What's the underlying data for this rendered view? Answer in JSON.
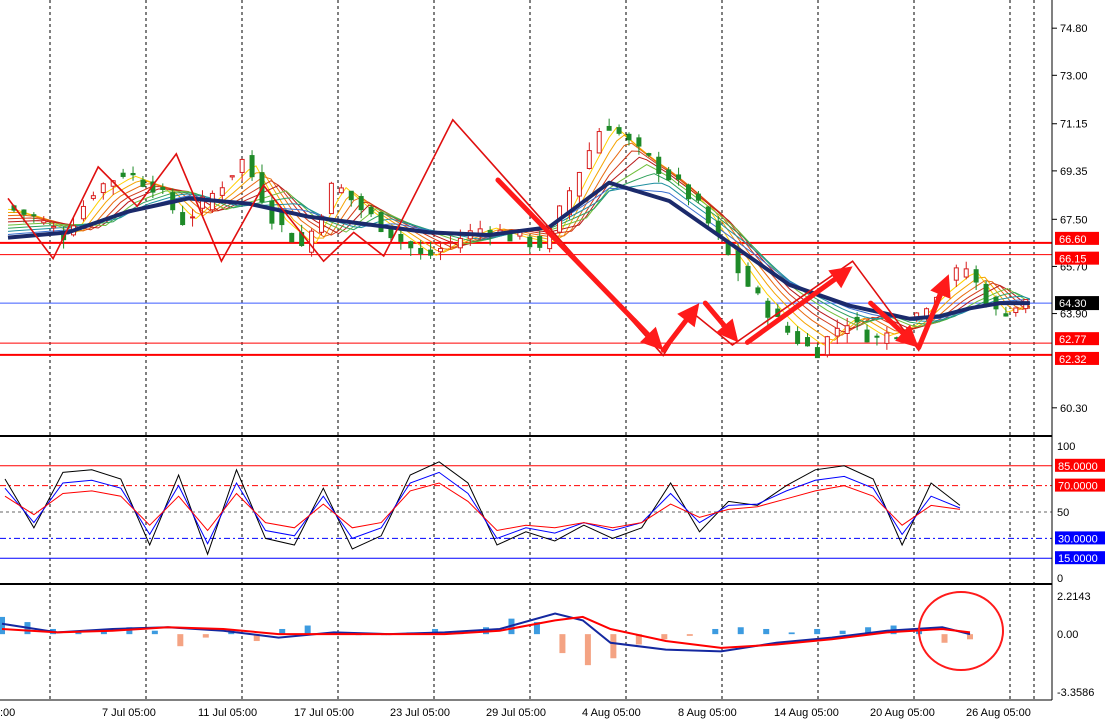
{
  "colors": {
    "background": "#ffffff",
    "grid": "#000000",
    "up_candle": "#d81e1e",
    "down_candle": "#1e8a28",
    "slow_ma": "#1b2a6b",
    "level_line": "#ff0000",
    "current_price_line": "#3b5bff",
    "current_price_badge": "#000000",
    "level_badge": "#ff0000",
    "arrow": "#ff1a1a",
    "stoch_main": "#000000",
    "stoch_blue": "#0000ff",
    "stoch_red": "#ff0000",
    "osc_hist_up": "#3c9be0",
    "osc_hist_down": "#f4a383",
    "osc_signal": "#ff0000",
    "osc_main": "#1428a0",
    "circle": "#ff1a1a"
  },
  "chart_data": [
    {
      "type": "candlestick",
      "panel": "price",
      "ylim": [
        59.3,
        75.8
      ],
      "y_ticks": [
        "74.80",
        "73.00",
        "71.15",
        "69.35",
        "67.50",
        "65.70",
        "63.90",
        "60.30"
      ],
      "x_labels": [
        ":00",
        "7 Jul 05:00",
        "11 Jul 05:00",
        "17 Jul 05:00",
        "23 Jul 05:00",
        "29 Jul 05:00",
        "4 Aug 05:00",
        "8 Aug 05:00",
        "14 Aug 05:00",
        "20 Aug 05:00",
        "26 Aug 05:00"
      ],
      "x_slots": 35,
      "close_path": [
        [
          0,
          68.0
        ],
        [
          1,
          67.6
        ],
        [
          2,
          66.9
        ],
        [
          3,
          68.6
        ],
        [
          4,
          69.3
        ],
        [
          5,
          68.8
        ],
        [
          6,
          67.4
        ],
        [
          7,
          68.5
        ],
        [
          8,
          69.8
        ],
        [
          9,
          67.5
        ],
        [
          10,
          66.4
        ],
        [
          11,
          68.9
        ],
        [
          12,
          67.8
        ],
        [
          13,
          66.9
        ],
        [
          14,
          66.0
        ],
        [
          15,
          66.7
        ],
        [
          16,
          67.2
        ],
        [
          17,
          66.8
        ],
        [
          18,
          66.5
        ],
        [
          19,
          69.0
        ],
        [
          20,
          71.3
        ],
        [
          21,
          70.2
        ],
        [
          22,
          69.3
        ],
        [
          23,
          68.2
        ],
        [
          24,
          66.3
        ],
        [
          25,
          64.6
        ],
        [
          26,
          63.3
        ],
        [
          27,
          62.4
        ],
        [
          28,
          63.7
        ],
        [
          29,
          62.9
        ],
        [
          30,
          63.4
        ],
        [
          31,
          64.7
        ],
        [
          32,
          65.7
        ],
        [
          33,
          63.9
        ],
        [
          34,
          64.3
        ]
      ],
      "slow_ma": [
        [
          0,
          66.8
        ],
        [
          2,
          67.0
        ],
        [
          4,
          67.8
        ],
        [
          6,
          68.3
        ],
        [
          8,
          68.1
        ],
        [
          10,
          67.6
        ],
        [
          12,
          67.3
        ],
        [
          14,
          67.0
        ],
        [
          16,
          66.9
        ],
        [
          18,
          67.2
        ],
        [
          20,
          68.9
        ],
        [
          22,
          68.2
        ],
        [
          24,
          66.6
        ],
        [
          26,
          65.0
        ],
        [
          28,
          64.2
        ],
        [
          30,
          63.7
        ],
        [
          31,
          63.8
        ],
        [
          32,
          64.1
        ],
        [
          33,
          64.3
        ],
        [
          34,
          64.3
        ]
      ],
      "current_price": "64.30",
      "levels": [
        "66.60",
        "66.15",
        "62.77",
        "62.32"
      ],
      "zigzag": [
        [
          0,
          68.3
        ],
        [
          1.5,
          66.0
        ],
        [
          3,
          69.5
        ],
        [
          4.3,
          68.0
        ],
        [
          5.6,
          70.0
        ],
        [
          7.1,
          65.9
        ],
        [
          8.5,
          68.8
        ],
        [
          10.5,
          65.9
        ],
        [
          11.5,
          67.0
        ],
        [
          12.5,
          66.1
        ],
        [
          14.8,
          71.3
        ],
        [
          21.8,
          62.3
        ],
        [
          22.7,
          64.0
        ],
        [
          24.1,
          62.7
        ],
        [
          28.1,
          65.9
        ],
        [
          30.3,
          62.5
        ],
        [
          31,
          64.8
        ]
      ],
      "arrows": [
        [
          [
            16.3,
            69.0
          ],
          [
            21.8,
            62.5
          ]
        ],
        [
          [
            21.8,
            62.5
          ],
          [
            23.0,
            64.3
          ]
        ],
        [
          [
            23.2,
            64.3
          ],
          [
            24.3,
            62.8
          ]
        ],
        [
          [
            24.6,
            62.8
          ],
          [
            28.1,
            65.7
          ]
        ],
        [
          [
            28.7,
            64.3
          ],
          [
            30.3,
            62.6
          ]
        ],
        [
          [
            30.3,
            62.6
          ],
          [
            31.3,
            65.4
          ]
        ]
      ]
    },
    {
      "type": "line",
      "panel": "stochastic",
      "ylim": [
        0,
        100
      ],
      "y_ticks": [
        "100",
        "50",
        "0"
      ],
      "levels": [
        "85.0000",
        "70.0000",
        "30.0000",
        "15.0000"
      ],
      "series": [
        {
          "values": [
            [
              0,
              75
            ],
            [
              1,
              38
            ],
            [
              2,
              80
            ],
            [
              3,
              82
            ],
            [
              4,
              75
            ],
            [
              5,
              25
            ],
            [
              6,
              78
            ],
            [
              7,
              18
            ],
            [
              8,
              82
            ],
            [
              9,
              30
            ],
            [
              10,
              25
            ],
            [
              11,
              68
            ],
            [
              12,
              22
            ],
            [
              13,
              32
            ],
            [
              14,
              78
            ],
            [
              15,
              88
            ],
            [
              16,
              72
            ],
            [
              17,
              25
            ],
            [
              18,
              35
            ],
            [
              19,
              28
            ],
            [
              20,
              40
            ],
            [
              21,
              30
            ],
            [
              22,
              38
            ],
            [
              23,
              72
            ],
            [
              24,
              35
            ],
            [
              25,
              58
            ],
            [
              26,
              55
            ],
            [
              27,
              70
            ],
            [
              28,
              82
            ],
            [
              29,
              85
            ],
            [
              30,
              75
            ],
            [
              31,
              25
            ],
            [
              32,
              72
            ],
            [
              33,
              55
            ]
          ]
        },
        {
          "values": [
            [
              0,
              68
            ],
            [
              1,
              42
            ],
            [
              2,
              72
            ],
            [
              3,
              74
            ],
            [
              4,
              68
            ],
            [
              5,
              33
            ],
            [
              6,
              70
            ],
            [
              7,
              26
            ],
            [
              8,
              72
            ],
            [
              9,
              36
            ],
            [
              10,
              32
            ],
            [
              11,
              62
            ],
            [
              12,
              30
            ],
            [
              13,
              38
            ],
            [
              14,
              72
            ],
            [
              15,
              80
            ],
            [
              16,
              64
            ],
            [
              17,
              30
            ],
            [
              18,
              38
            ],
            [
              19,
              34
            ],
            [
              20,
              42
            ],
            [
              21,
              36
            ],
            [
              22,
              42
            ],
            [
              23,
              64
            ],
            [
              24,
              42
            ],
            [
              25,
              55
            ],
            [
              26,
              56
            ],
            [
              27,
              66
            ],
            [
              28,
              74
            ],
            [
              29,
              77
            ],
            [
              30,
              68
            ],
            [
              31,
              33
            ],
            [
              32,
              62
            ],
            [
              33,
              53
            ]
          ]
        },
        {
          "values": [
            [
              0,
              62
            ],
            [
              1,
              48
            ],
            [
              2,
              64
            ],
            [
              3,
              66
            ],
            [
              4,
              62
            ],
            [
              5,
              40
            ],
            [
              6,
              62
            ],
            [
              7,
              36
            ],
            [
              8,
              64
            ],
            [
              9,
              42
            ],
            [
              10,
              38
            ],
            [
              11,
              56
            ],
            [
              12,
              38
            ],
            [
              13,
              42
            ],
            [
              14,
              66
            ],
            [
              15,
              72
            ],
            [
              16,
              58
            ],
            [
              17,
              36
            ],
            [
              18,
              40
            ],
            [
              19,
              38
            ],
            [
              20,
              42
            ],
            [
              21,
              38
            ],
            [
              22,
              42
            ],
            [
              23,
              56
            ],
            [
              24,
              46
            ],
            [
              25,
              52
            ],
            [
              26,
              54
            ],
            [
              27,
              60
            ],
            [
              28,
              66
            ],
            [
              29,
              70
            ],
            [
              30,
              62
            ],
            [
              31,
              40
            ],
            [
              32,
              55
            ],
            [
              33,
              52
            ]
          ]
        }
      ]
    },
    {
      "type": "bar",
      "panel": "macd",
      "ylim": [
        -3.3586,
        2.2143
      ],
      "y_ticks": [
        "2.2143",
        "0.00",
        "-3.3586"
      ],
      "histogram": [
        1.0,
        0.7,
        0.3,
        0.1,
        0.2,
        0.4,
        0.2,
        -0.7,
        -0.2,
        0.3,
        -0.4,
        0.3,
        0.5,
        0.1,
        0.0,
        0.0,
        0.1,
        0.3,
        0.2,
        0.4,
        0.9,
        0.7,
        -1.1,
        -1.8,
        -1.4,
        -0.6,
        -0.3,
        -0.1,
        0.3,
        0.4,
        0.3,
        0.1,
        0.3,
        0.2,
        0.4,
        0.5,
        0.3,
        -0.5,
        -0.3
      ],
      "series": [
        {
          "values": [
            [
              0,
              0.6
            ],
            [
              2,
              0.1
            ],
            [
              4,
              0.3
            ],
            [
              6,
              0.4
            ],
            [
              8,
              0.2
            ],
            [
              10,
              -0.2
            ],
            [
              12,
              0.1
            ],
            [
              14,
              0.0
            ],
            [
              16,
              0.1
            ],
            [
              18,
              0.3
            ],
            [
              20,
              1.2
            ],
            [
              21,
              0.8
            ],
            [
              22,
              -0.5
            ],
            [
              24,
              -0.9
            ],
            [
              26,
              -1.0
            ],
            [
              28,
              -0.5
            ],
            [
              30,
              -0.2
            ],
            [
              32,
              0.2
            ],
            [
              34,
              0.4
            ],
            [
              35,
              0.0
            ]
          ]
        },
        {
          "values": [
            [
              0,
              0.3
            ],
            [
              2,
              0.1
            ],
            [
              4,
              0.2
            ],
            [
              6,
              0.4
            ],
            [
              8,
              0.3
            ],
            [
              10,
              0.0
            ],
            [
              12,
              0.0
            ],
            [
              14,
              0.0
            ],
            [
              16,
              0.0
            ],
            [
              18,
              0.2
            ],
            [
              20,
              0.8
            ],
            [
              21,
              1.0
            ],
            [
              22,
              0.3
            ],
            [
              24,
              -0.4
            ],
            [
              26,
              -0.8
            ],
            [
              28,
              -0.6
            ],
            [
              30,
              -0.3
            ],
            [
              32,
              0.1
            ],
            [
              34,
              0.3
            ],
            [
              35,
              0.1
            ]
          ]
        }
      ]
    }
  ]
}
